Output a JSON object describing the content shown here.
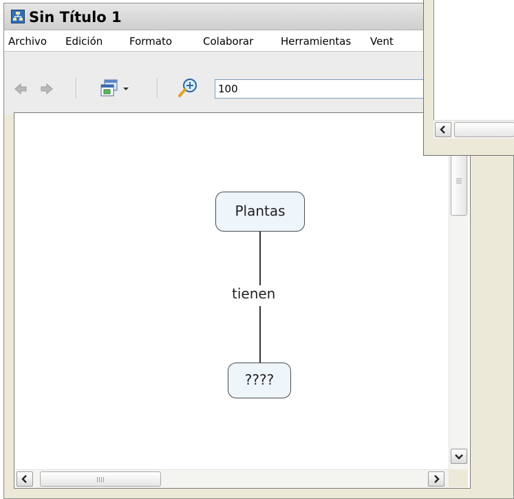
{
  "window": {
    "title": "Sin Título 1"
  },
  "menu": {
    "items": [
      "Archivo",
      "Edición",
      "Formato",
      "Colaborar",
      "Herramientas",
      "Vent"
    ]
  },
  "toolbar": {
    "back_icon": "arrow-left-icon",
    "forward_icon": "arrow-right-icon",
    "view_icon": "window-view-icon",
    "zoom_icon": "zoom-in-icon",
    "zoom_value": "100"
  },
  "concept_map": {
    "concept_top": "Plantas",
    "linking_phrase": "tienen",
    "concept_bottom": "????"
  },
  "scrollbars": {
    "horizontal_left_arrow": "chevron-left-icon",
    "horizontal_right_arrow": "chevron-right-icon",
    "vertical_down_arrow": "chevron-down-icon"
  },
  "colors": {
    "concept_fill": "#eef5fb",
    "concept_border": "#4a4a4a",
    "window_bg": "#ece9d8"
  }
}
